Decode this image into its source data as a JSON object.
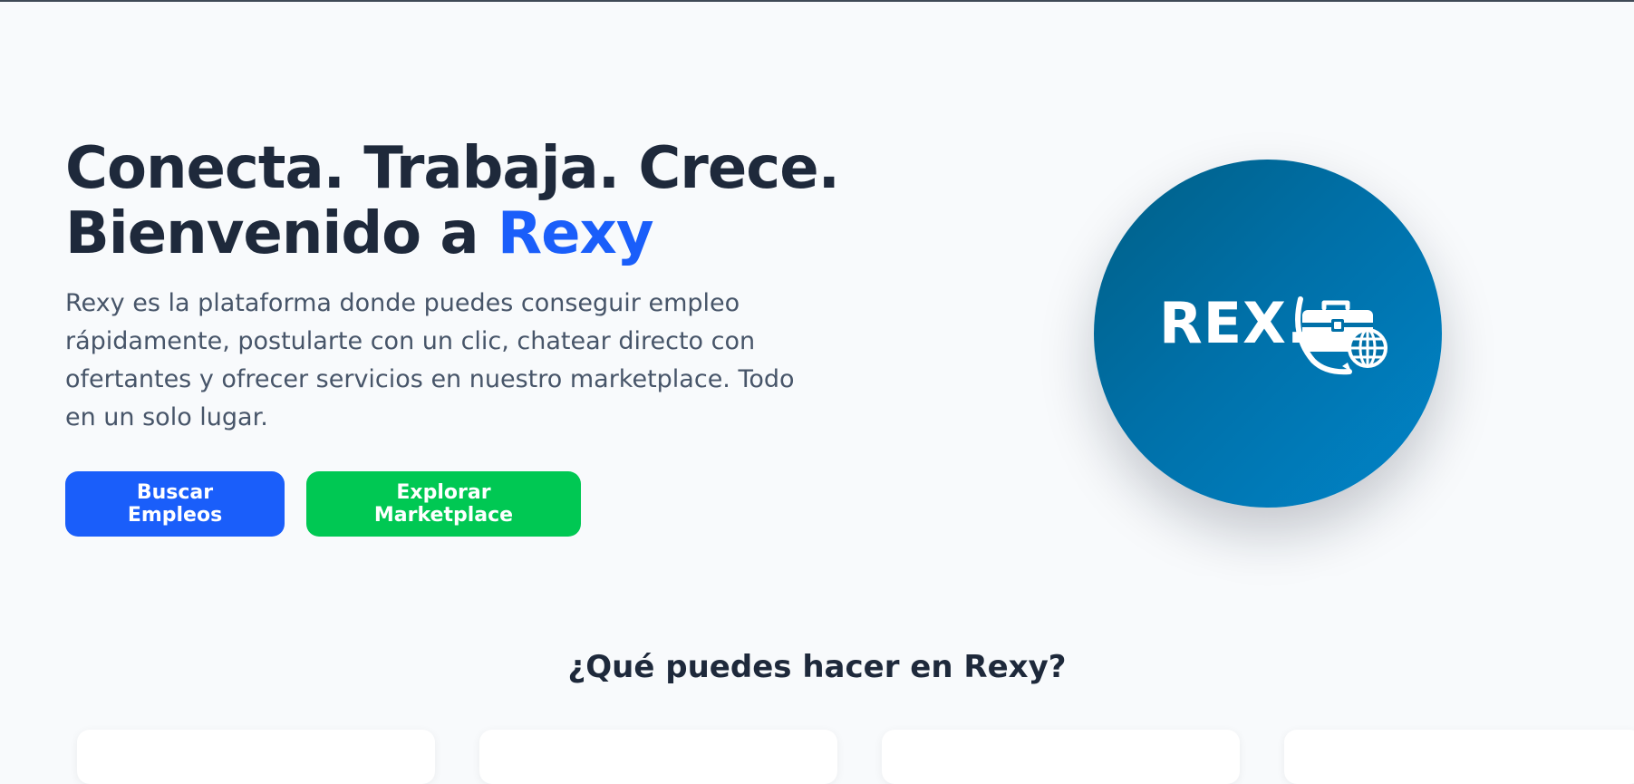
{
  "hero": {
    "headline_line1": "Conecta. Trabaja. Crece.",
    "headline_prefix": "Bienvenido a ",
    "headline_brand": "Rexy",
    "description": "Rexy es la plataforma donde puedes conseguir empleo rápidamente, postularte con un clic, chatear directo con ofertantes y ofrecer servicios en nuestro marketplace. Todo en un solo lugar.",
    "buttons": {
      "search_jobs": "Buscar Empleos",
      "explore_marketplace": "Explorar Marketplace"
    }
  },
  "logo": {
    "wordmark": "REX.",
    "icon": "briefcase-globe-icon"
  },
  "features": {
    "title": "¿Qué puedes hacer en Rexy?",
    "cards": [
      {
        "label": ""
      },
      {
        "label": ""
      },
      {
        "label": ""
      },
      {
        "label": ""
      }
    ]
  },
  "colors": {
    "accent": "#1a5efa",
    "green": "#00c853",
    "heading": "#1e293b",
    "body_text": "#475569",
    "background": "#f8fafc",
    "logo_gradient_start": "#005f86",
    "logo_gradient_end": "#0184c8"
  }
}
